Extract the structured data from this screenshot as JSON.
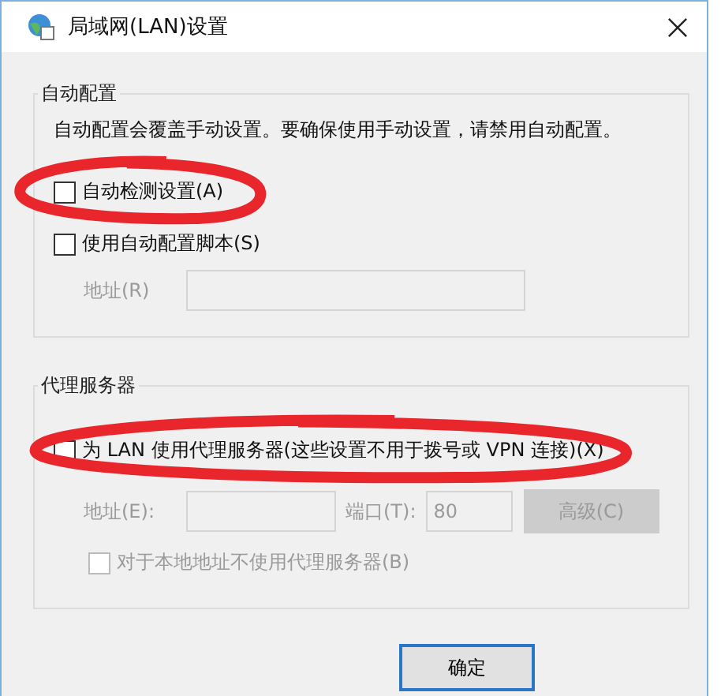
{
  "window": {
    "title": "局域网(LAN)设置"
  },
  "groups": [
    {
      "title": "自动配置",
      "items": [
        {
          "kind": "text",
          "text": "自动配置会覆盖手动设置。要确保使用手动设置，请禁用自动配置。"
        },
        {
          "kind": "checkbox",
          "label": "自动检测设置(A)",
          "checked": false,
          "disabled": false,
          "highlighted": true
        },
        {
          "kind": "checkbox",
          "label": "使用自动配置脚本(S)",
          "checked": false,
          "disabled": false,
          "highlighted": false
        },
        {
          "kind": "address",
          "label": "地址(R)",
          "disabled": true
        }
      ]
    },
    {
      "title": "代理服务器",
      "items": [
        {
          "kind": "checkbox",
          "label": "为 LAN 使用代理服务器(这些设置不用于拨号或 VPN 连接)(X)",
          "checked": false,
          "disabled": false,
          "highlighted": true
        },
        {
          "kind": "proxy",
          "address_label": "地址(E):",
          "port_label": "端口(T):",
          "port": "80",
          "button": "高级(C)",
          "disabled": true
        },
        {
          "kind": "sub-checkbox",
          "label": "对于本地地址不使用代理服务器(B)",
          "checked": false,
          "disabled": true,
          "highlighted": false
        }
      ]
    }
  ],
  "buttons": [
    {
      "label": "确定",
      "default": true
    }
  ]
}
